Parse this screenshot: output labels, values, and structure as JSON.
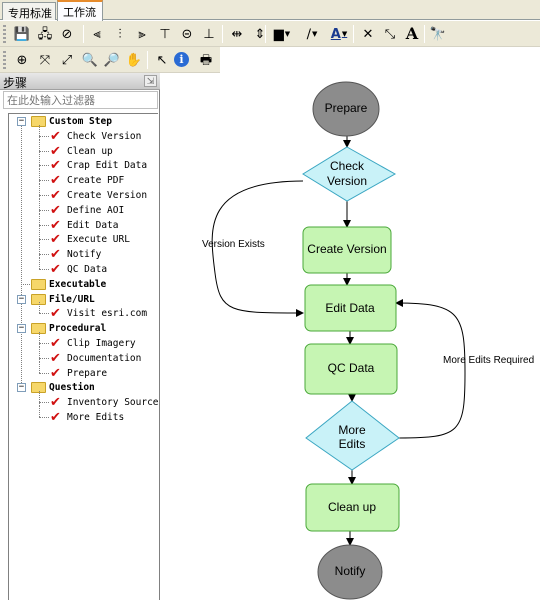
{
  "tabs": [
    {
      "label": "专用标准",
      "active": false
    },
    {
      "label": "工作流",
      "active": true
    }
  ],
  "toolbar1": {
    "buttons": [
      {
        "name": "save-icon",
        "glyph": "💾"
      },
      {
        "name": "workflow-properties-icon",
        "glyph": "🖧"
      },
      {
        "name": "clear-icon",
        "glyph": "⊘"
      },
      {
        "name": "align-left-icon",
        "glyph": "⫷"
      },
      {
        "name": "align-center-icon",
        "glyph": "⫶"
      },
      {
        "name": "align-right-icon",
        "glyph": "⫸"
      },
      {
        "name": "align-top-icon",
        "glyph": "⊤"
      },
      {
        "name": "align-middle-icon",
        "glyph": "⊝"
      },
      {
        "name": "align-bottom-icon",
        "glyph": "⊥"
      },
      {
        "name": "distribute-horizontal-icon",
        "glyph": "⇹"
      },
      {
        "name": "distribute-vertical-icon",
        "glyph": "⇕"
      },
      {
        "name": "fill-color-icon",
        "glyph": "▆"
      },
      {
        "name": "line-color-icon",
        "glyph": "∕"
      },
      {
        "name": "font-color-icon",
        "glyph": "A"
      },
      {
        "name": "delete-icon",
        "glyph": "✕"
      },
      {
        "name": "connect-icon",
        "glyph": "⤡"
      },
      {
        "name": "text-icon",
        "glyph": "A"
      },
      {
        "name": "find-icon",
        "glyph": "🔭"
      }
    ]
  },
  "toolbar2": {
    "buttons": [
      {
        "name": "pan-to-center-icon",
        "glyph": "⊕"
      },
      {
        "name": "fit-to-window-icon",
        "glyph": "⤧"
      },
      {
        "name": "full-extent-icon",
        "glyph": "⤢"
      },
      {
        "name": "zoom-in-icon",
        "glyph": "🔍"
      },
      {
        "name": "zoom-out-icon",
        "glyph": "🔎"
      },
      {
        "name": "pan-hand-icon",
        "glyph": "✋"
      },
      {
        "name": "select-pointer-icon",
        "glyph": "↖"
      },
      {
        "name": "info-icon",
        "glyph": "i"
      },
      {
        "name": "print-icon",
        "glyph": "🖶"
      }
    ]
  },
  "steps_panel": {
    "title": "步骤",
    "filter_placeholder": "在此处输入过滤器",
    "tree": [
      {
        "label": "Custom Step",
        "children": [
          "Check Version",
          "Clean up",
          "Crap Edit Data",
          "Create PDF",
          "Create Version",
          "Define AOI",
          "Edit Data",
          "Execute URL",
          "Notify",
          "QC Data"
        ]
      },
      {
        "label": "Executable",
        "children": []
      },
      {
        "label": "File/URL",
        "children": [
          "Visit esri.com"
        ]
      },
      {
        "label": "Procedural",
        "children": [
          "Clip Imagery",
          "Documentation",
          "Prepare"
        ]
      },
      {
        "label": "Question",
        "children": [
          "Inventory Source",
          "More Edits"
        ]
      }
    ]
  },
  "workflow": {
    "nodes": {
      "prepare": "Prepare",
      "check_version": [
        "Check",
        "Version"
      ],
      "create_version": "Create Version",
      "edit_data": "Edit Data",
      "qc_data": "QC Data",
      "more_edits": [
        "More",
        "Edits"
      ],
      "clean_up": "Clean up",
      "notify": "Notify"
    },
    "edge_labels": {
      "version_exists": "Version Exists",
      "more_edits_required": "More Edits Required"
    },
    "colors": {
      "terminal_fill": "#8c8c8c",
      "step_fill": "#c6f5b3",
      "step_stroke": "#4aa83a",
      "decision_fill": "#c9f2f8",
      "decision_stroke": "#3aa6c2"
    }
  }
}
